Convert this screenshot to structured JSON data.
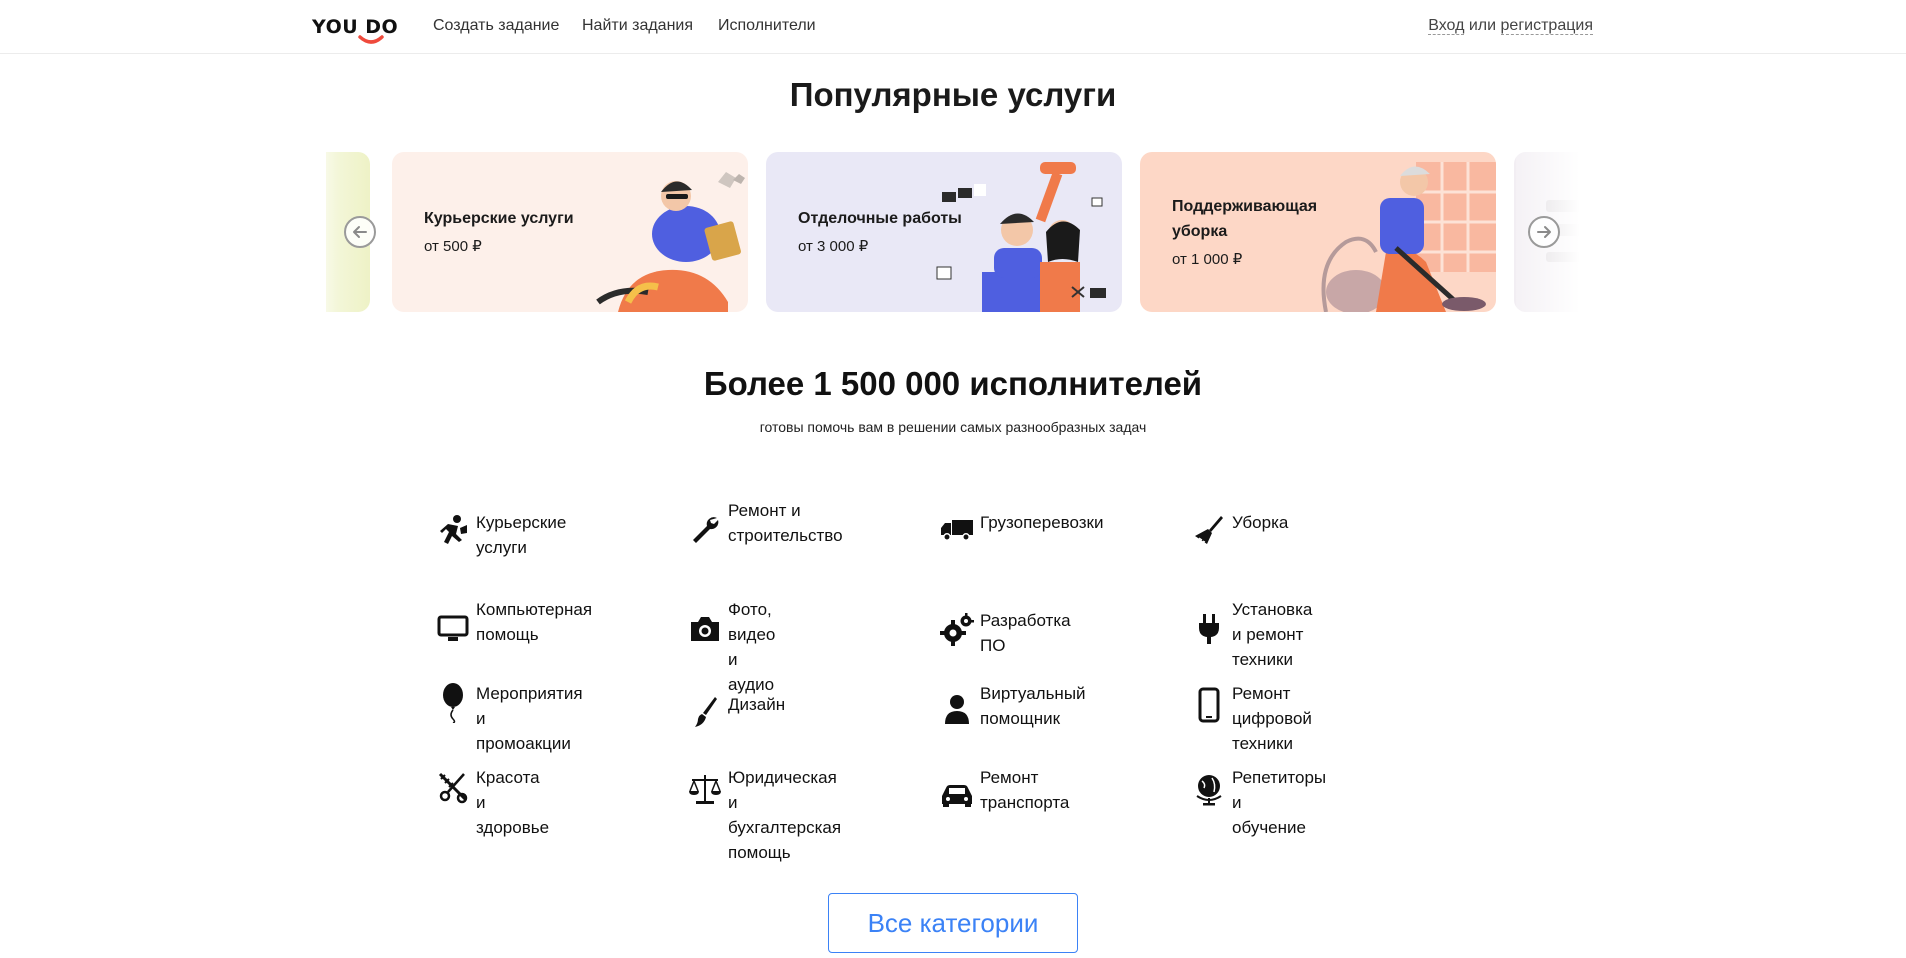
{
  "header": {
    "logo_text": "YOU DO",
    "nav": {
      "create_task": "Создать задание",
      "find_tasks": "Найти задания",
      "performers": "Исполнители"
    },
    "auth": {
      "login": "Вход",
      "or": "или",
      "register": "регистрация"
    }
  },
  "popular": {
    "title": "Популярные услуги",
    "cards": [
      {
        "title": "Курьерские услуги",
        "price": "от 500 ₽",
        "background": "#fdf0ea"
      },
      {
        "title": "Отделочные работы",
        "price": "от 3 000 ₽",
        "background": "#e9e8f6"
      },
      {
        "title": "Поддерживающая уборка",
        "price": "от 1 000 ₽",
        "background": "#fdd7c6"
      }
    ]
  },
  "performers": {
    "title": "Более 1 500 000 исполнителей",
    "subtitle": "готовы помочь вам в решении самых разнообразных задач"
  },
  "categories": [
    {
      "label": "Курьерские услуги",
      "icon": "courier-icon"
    },
    {
      "label": "Ремонт и\nстроительство",
      "icon": "wrench-icon"
    },
    {
      "label": "Грузоперевозки",
      "icon": "truck-icon"
    },
    {
      "label": "Уборка",
      "icon": "broom-icon"
    },
    {
      "label": "Компьютерная\nпомощь",
      "icon": "monitor-icon"
    },
    {
      "label": "Фото, видео и аудио",
      "icon": "camera-icon"
    },
    {
      "label": "Разработка ПО",
      "icon": "gears-icon"
    },
    {
      "label": "Установка и ремонт\nтехники",
      "icon": "plug-icon"
    },
    {
      "label": "Мероприятия и\nпромоакции",
      "icon": "balloon-icon"
    },
    {
      "label": "Дизайн",
      "icon": "brush-icon"
    },
    {
      "label": "Виртуальный\nпомощник",
      "icon": "person-icon"
    },
    {
      "label": "Ремонт цифровой\nтехники",
      "icon": "phone-icon"
    },
    {
      "label": "Красота и здоровье",
      "icon": "comb-scissors-icon"
    },
    {
      "label": "Юридическая\nи бухгалтерская\nпомощь",
      "icon": "scales-icon"
    },
    {
      "label": "Ремонт транспорта",
      "icon": "car-icon"
    },
    {
      "label": "Репетиторы и\nобучение",
      "icon": "globe-icon"
    }
  ],
  "all_categories_button": "Все категории",
  "colors": {
    "accent_blue": "#3b82f6",
    "logo_smile": "#ef4a3c"
  }
}
